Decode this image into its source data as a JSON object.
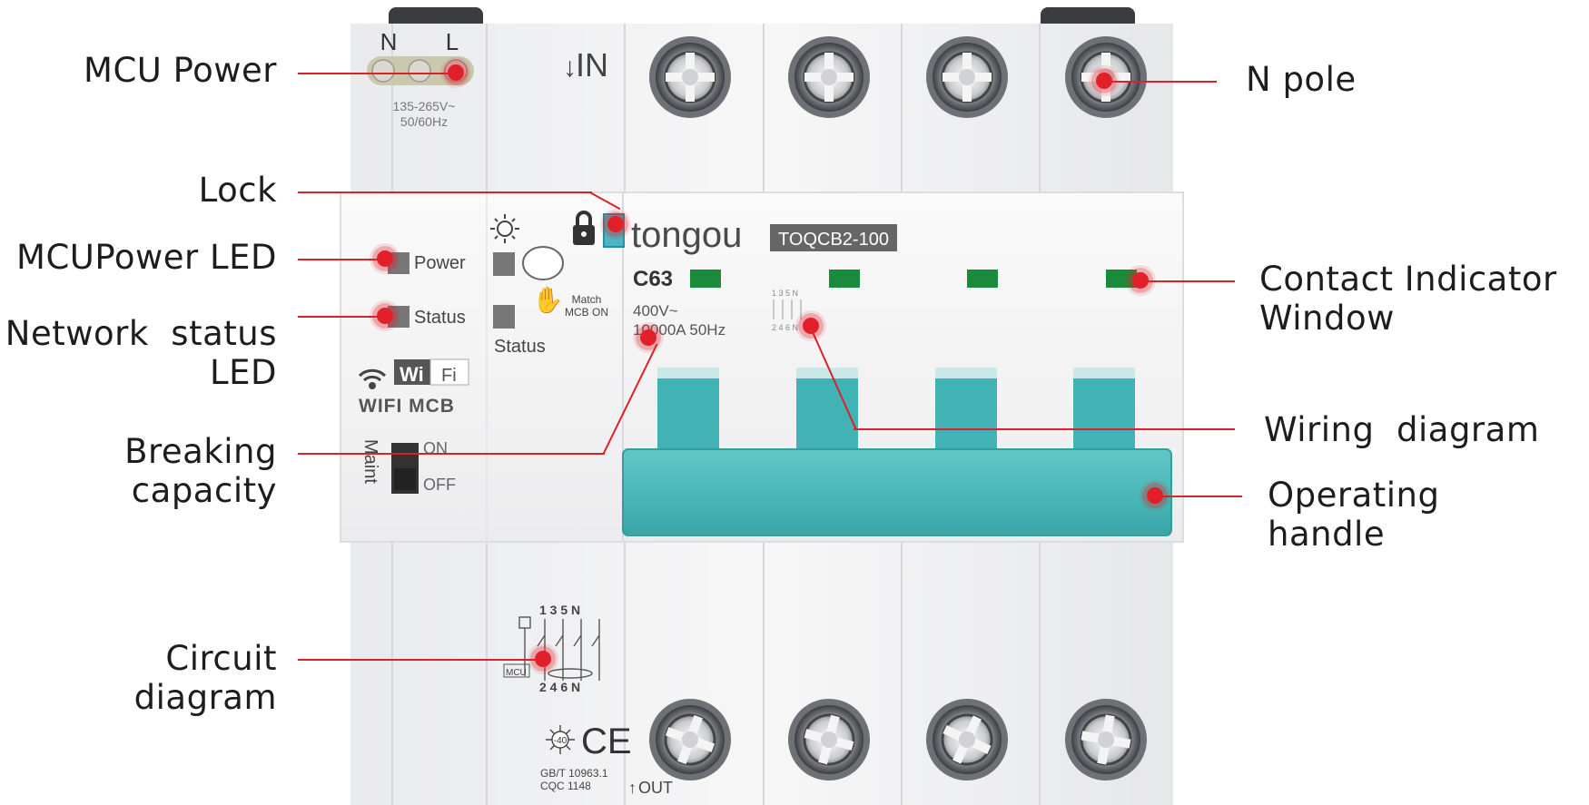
{
  "device": {
    "terminal_n": "N",
    "terminal_l": "L",
    "voltage_range": "135-265V~",
    "frequency": "50/60Hz",
    "in_label": "IN",
    "out_label": "OUT",
    "power_led_label": "Power",
    "status_led_label": "Status",
    "status_button_label": "Status",
    "match_label_1": "Match",
    "match_label_2": "MCB ON",
    "wifi_badge_a": "Wi",
    "wifi_badge_b": "Fi",
    "wifi_mcb_label": "WIFI MCB",
    "maint_label": "Maint",
    "on_label": "ON",
    "off_label": "OFF",
    "brand": "tongou",
    "model": "TOQCB2-100",
    "curve_rating": "C63",
    "rated_voltage": "400V~",
    "breaking_capacity": "10000A  50Hz",
    "wiring_top": "1 3 5 N",
    "wiring_bottom": "2 4 6 N",
    "circuit_top": "1  3  5  N",
    "circuit_bottom": "2  4  6  N",
    "mcu_box": "MCU",
    "temp_mark": "-40",
    "ce_mark": "CE",
    "standard_1": "GB/T 10963.1",
    "standard_2": "CQC 1148",
    "colors": {
      "housing": "#f1f2f3",
      "handle": "#47b9b9",
      "indicator": "#1c8a3c",
      "callout_red": "#e2202a"
    }
  },
  "callouts": {
    "mcu_power": "MCU Power",
    "lock": "Lock",
    "mcu_power_led": "MCUPower LED",
    "network_status_led": "Network  status\nLED",
    "breaking_capacity": "Breaking\ncapacity",
    "circuit_diagram": "Circuit\ndiagram",
    "n_pole": "N pole",
    "contact_indicator_window": "Contact Indicator\nWindow",
    "wiring_diagram": "Wiring  diagram",
    "operating_handle": "Operating\nhandle"
  }
}
